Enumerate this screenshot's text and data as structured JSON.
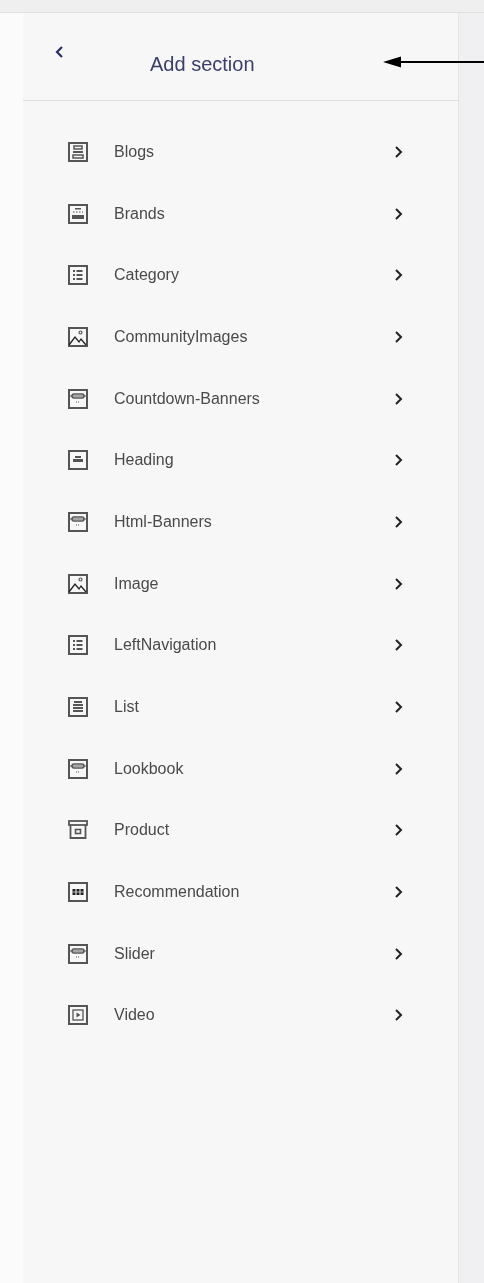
{
  "header": {
    "title": "Add section"
  },
  "sections": [
    {
      "label": "Blogs"
    },
    {
      "label": "Brands"
    },
    {
      "label": "Category"
    },
    {
      "label": "CommunityImages"
    },
    {
      "label": "Countdown-Banners"
    },
    {
      "label": "Heading"
    },
    {
      "label": "Html-Banners"
    },
    {
      "label": "Image"
    },
    {
      "label": "LeftNavigation"
    },
    {
      "label": "List"
    },
    {
      "label": "Lookbook"
    },
    {
      "label": "Product"
    },
    {
      "label": "Recommendation"
    },
    {
      "label": "Slider"
    },
    {
      "label": "Video"
    }
  ]
}
